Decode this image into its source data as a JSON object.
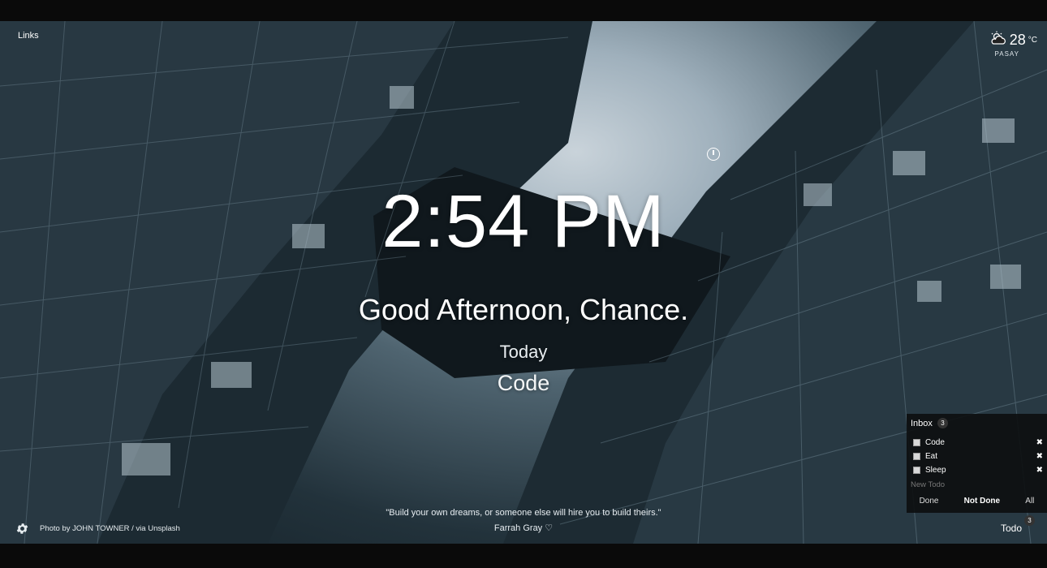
{
  "links_label": "Links",
  "weather": {
    "temp": "28",
    "unit": "°C",
    "location": "PASAY",
    "icon": "partly-cloudy-icon"
  },
  "clock": "2:54 PM",
  "greeting": "Good Afternoon, Chance.",
  "focus": {
    "label": "Today",
    "value": "Code"
  },
  "quote": {
    "text": "\"Build your own dreams, or someone else will hire you to build theirs.\"",
    "author": "Farrah Gray ♡"
  },
  "photo_credit": {
    "prefix": "Photo by ",
    "author": "JOHN TOWNER",
    "separator": " / via ",
    "source": "Unsplash"
  },
  "todo": {
    "inbox_label": "Inbox",
    "count": "3",
    "items": [
      {
        "label": "Code",
        "done": false
      },
      {
        "label": "Eat",
        "done": false
      },
      {
        "label": "Sleep",
        "done": false
      }
    ],
    "new_placeholder": "New Todo",
    "filters": {
      "done": "Done",
      "not_done": "Not Done",
      "all": "All"
    },
    "active_filter": "Not Done",
    "toggle_label": "Todo",
    "toggle_count": "3"
  }
}
